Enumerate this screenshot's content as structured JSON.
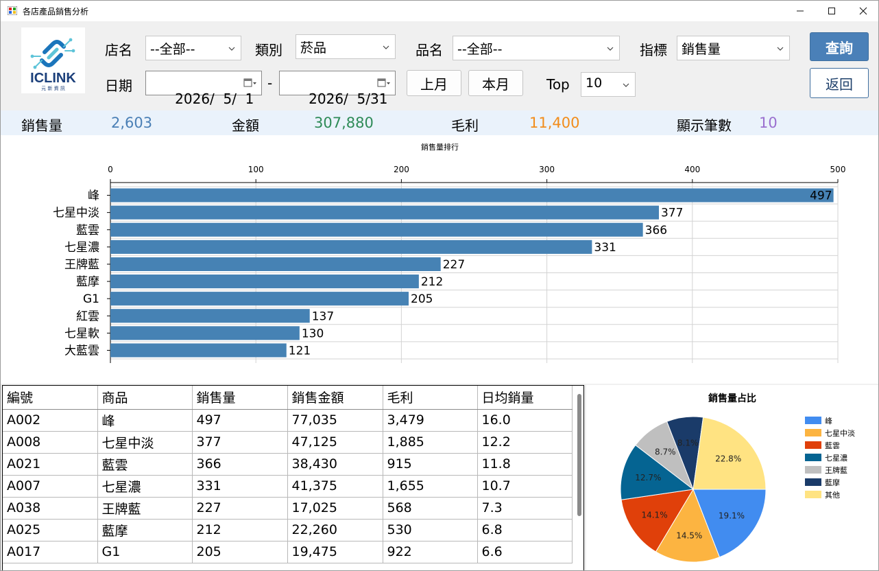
{
  "window": {
    "title": "各店產品銷售分析",
    "controls": [
      "minimize",
      "maximize",
      "close"
    ]
  },
  "logo": {
    "brand": "ICLINK",
    "subtitle": "元 新 資 訊"
  },
  "filters": {
    "store_label": "店名",
    "store_value": "--全部--",
    "category_label": "類別",
    "category_value": "菸品",
    "product_label": "品名",
    "product_value": "--全部--",
    "metric_label": "指標",
    "metric_value": "銷售量",
    "date_label": "日期",
    "date_from": "2026/  5/  1",
    "date_separator": "-",
    "date_to": "2026/  5/31",
    "prev_month_label": "上月",
    "this_month_label": "本月",
    "top_label": "Top",
    "top_value": "10",
    "query_label": "查詢",
    "back_label": "返回"
  },
  "summary": {
    "qty_label": "銷售量",
    "qty_value": "2,603",
    "qty_color": "#4a7fb5",
    "amount_label": "金額",
    "amount_value": "307,880",
    "amount_color": "#2e8b57",
    "profit_label": "毛利",
    "profit_value": "11,400",
    "profit_color": "#f28c1a",
    "count_label": "顯示筆數",
    "count_value": "10",
    "count_color": "#9a6fcf"
  },
  "table": {
    "headers": [
      "編號",
      "商品",
      "銷售量",
      "銷售金額",
      "毛利",
      "日均銷量"
    ],
    "rows": [
      [
        "A002",
        "峰",
        "497",
        "77,035",
        "3,479",
        "16.0"
      ],
      [
        "A008",
        "七星中淡",
        "377",
        "47,125",
        "1,885",
        "12.2"
      ],
      [
        "A021",
        "藍雲",
        "366",
        "38,430",
        "915",
        "11.8"
      ],
      [
        "A007",
        "七星濃",
        "331",
        "41,375",
        "1,655",
        "10.7"
      ],
      [
        "A038",
        "王牌藍",
        "227",
        "17,025",
        "568",
        "7.3"
      ],
      [
        "A025",
        "藍摩",
        "212",
        "22,260",
        "530",
        "6.8"
      ],
      [
        "A017",
        "G1",
        "205",
        "19,475",
        "922",
        "6.6"
      ]
    ]
  },
  "chart_data": [
    {
      "type": "bar",
      "orientation": "horizontal",
      "title": "銷售量排行",
      "categories": [
        "峰",
        "七星中淡",
        "藍雲",
        "七星濃",
        "王牌藍",
        "藍摩",
        "G1",
        "紅雲",
        "七星軟",
        "大藍雲"
      ],
      "values": [
        497,
        377,
        366,
        331,
        227,
        212,
        205,
        137,
        130,
        121
      ],
      "xlim": [
        0,
        500
      ],
      "xticks": [
        0,
        100,
        200,
        300,
        400,
        500
      ],
      "axis_position": "top",
      "grid": true,
      "bar_color": "#4682b4"
    },
    {
      "type": "pie",
      "title": "銷售量占比",
      "labels": [
        "峰",
        "七星中淡",
        "藍雲",
        "七星濃",
        "王牌藍",
        "藍摩",
        "其他"
      ],
      "values": [
        19.1,
        14.5,
        14.1,
        12.7,
        8.7,
        8.1,
        22.8
      ],
      "value_labels": [
        "19.1%",
        "14.5%",
        "14.1%",
        "12.7%",
        "8.7%",
        "8.1%",
        "22.8%"
      ],
      "colors": [
        "#418cf0",
        "#fcb441",
        "#e0400a",
        "#056492",
        "#bfbfbf",
        "#1a3b69",
        "#ffe382"
      ],
      "legend": "right"
    }
  ]
}
